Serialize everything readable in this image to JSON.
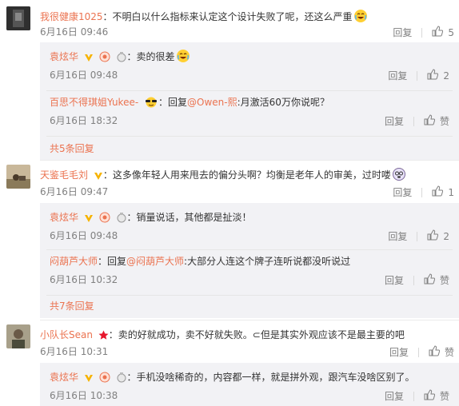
{
  "comments": [
    {
      "user": "我很健康1025",
      "text": "：不明白以什么指标来认定这个设计失败了呢，还这么严重",
      "time": "6月16日 09:46",
      "reply_label": "回复",
      "likes": "5",
      "replies": [
        {
          "user": "袁炫华",
          "text": "：卖的很差",
          "time": "6月16日 09:48",
          "reply_label": "回复",
          "likes": "2"
        },
        {
          "user": "百思不得琪姐Yukee-",
          "text_prefix": "：回复",
          "mention": "@Owen-熙",
          "text": ":月激活60万你说呢？",
          "time": "6月16日 18:32",
          "reply_label": "回复",
          "likes": "赞"
        }
      ],
      "more": "共5条回复"
    },
    {
      "user": "天鉴毛毛刘",
      "text": "：这多像年轻人用来甩去的偏分头啊？均衡是老年人的审美，过时喽",
      "time": "6月16日 09:47",
      "reply_label": "回复",
      "likes": "1",
      "replies": [
        {
          "user": "袁炫华",
          "text": "：销量说话，其他都是扯淡！",
          "time": "6月16日 09:48",
          "reply_label": "回复",
          "likes": "2"
        },
        {
          "user": "闷葫芦大师",
          "text_prefix": "：回复",
          "mention": "@闷葫芦大师",
          "text": ":大部分人连这个牌子连听说都没听说过",
          "time": "6月16日 10:32",
          "reply_label": "回复",
          "likes": "赞"
        }
      ],
      "more": "共7条回复"
    },
    {
      "user": "小队长Sean",
      "text": "：卖的好就成功，卖不好就失败。⊂但是其实外观应该不是最主要的吧",
      "time": "6月16日 10:31",
      "reply_label": "回复",
      "likes": "赞",
      "replies": [
        {
          "user": "袁炫华",
          "text": "：手机没啥稀奇的，内容都一样，就是拼外观，跟汽车没啥区别了。",
          "time": "6月16日 10:38",
          "reply_label": "回复",
          "likes": "赞"
        }
      ]
    }
  ],
  "colors": {
    "name": "#eb7350",
    "meta": "#808080",
    "sub_bg": "#f2f2f5",
    "text": "#333333"
  },
  "icons": [
    "thumb-up-icon",
    "gold-v-icon",
    "vip-icon",
    "medal-icon",
    "laugh-cry-emoji",
    "sunglasses-emoji",
    "red-star-icon"
  ]
}
